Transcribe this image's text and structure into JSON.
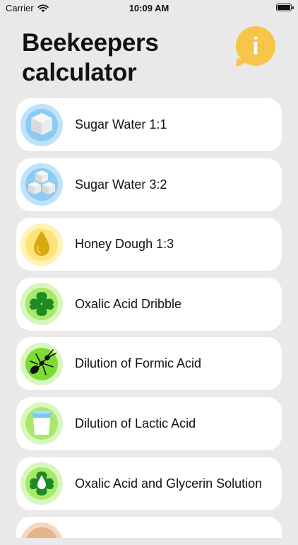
{
  "status_bar": {
    "carrier": "Carrier",
    "time": "10:09 AM"
  },
  "header": {
    "title_line1": "Beekeepers",
    "title_line2": "calculator",
    "info_label": "i"
  },
  "colors": {
    "background": "#e9e9e9",
    "card": "#ffffff",
    "info_yellow": "#f7c54a",
    "blue_ring": "#bfe3fb",
    "yellow_ring": "#fff3b5",
    "green_ring": "#a8e86a"
  },
  "items": [
    {
      "label": "Sugar Water 1:1",
      "icon": "sugar-cube-icon"
    },
    {
      "label": "Sugar Water 3:2",
      "icon": "sugar-cubes-icon"
    },
    {
      "label": "Honey Dough 1:3",
      "icon": "honey-drop-icon"
    },
    {
      "label": "Oxalic Acid Dribble",
      "icon": "clover-icon"
    },
    {
      "label": "Dilution of Formic Acid",
      "icon": "ant-icon"
    },
    {
      "label": "Dilution of Lactic Acid",
      "icon": "milk-glass-icon"
    },
    {
      "label": "Oxalic Acid and Glycerin Solution",
      "icon": "clover-drop-icon"
    }
  ]
}
